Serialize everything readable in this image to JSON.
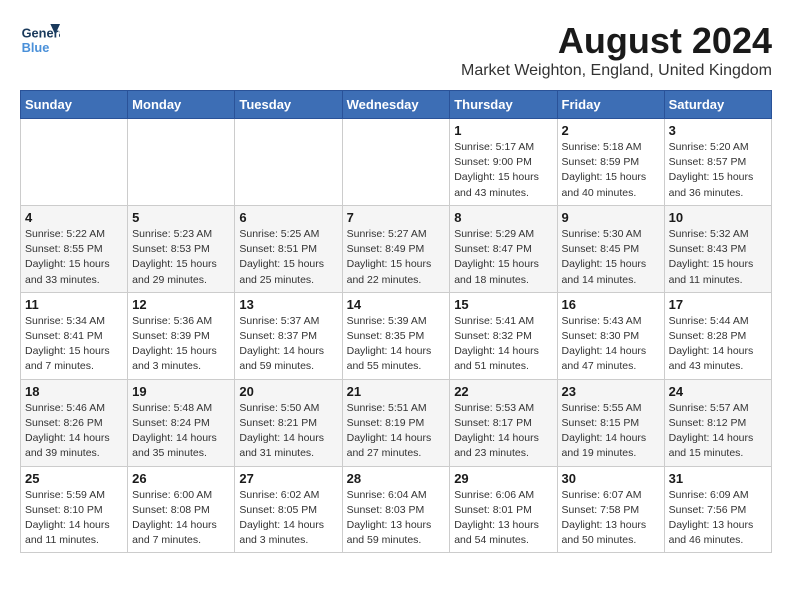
{
  "header": {
    "logo_general": "General",
    "logo_blue": "Blue",
    "month_year": "August 2024",
    "location": "Market Weighton, England, United Kingdom"
  },
  "weekdays": [
    "Sunday",
    "Monday",
    "Tuesday",
    "Wednesday",
    "Thursday",
    "Friday",
    "Saturday"
  ],
  "weeks": [
    [
      {
        "day": "",
        "info": ""
      },
      {
        "day": "",
        "info": ""
      },
      {
        "day": "",
        "info": ""
      },
      {
        "day": "",
        "info": ""
      },
      {
        "day": "1",
        "info": "Sunrise: 5:17 AM\nSunset: 9:00 PM\nDaylight: 15 hours\nand 43 minutes."
      },
      {
        "day": "2",
        "info": "Sunrise: 5:18 AM\nSunset: 8:59 PM\nDaylight: 15 hours\nand 40 minutes."
      },
      {
        "day": "3",
        "info": "Sunrise: 5:20 AM\nSunset: 8:57 PM\nDaylight: 15 hours\nand 36 minutes."
      }
    ],
    [
      {
        "day": "4",
        "info": "Sunrise: 5:22 AM\nSunset: 8:55 PM\nDaylight: 15 hours\nand 33 minutes."
      },
      {
        "day": "5",
        "info": "Sunrise: 5:23 AM\nSunset: 8:53 PM\nDaylight: 15 hours\nand 29 minutes."
      },
      {
        "day": "6",
        "info": "Sunrise: 5:25 AM\nSunset: 8:51 PM\nDaylight: 15 hours\nand 25 minutes."
      },
      {
        "day": "7",
        "info": "Sunrise: 5:27 AM\nSunset: 8:49 PM\nDaylight: 15 hours\nand 22 minutes."
      },
      {
        "day": "8",
        "info": "Sunrise: 5:29 AM\nSunset: 8:47 PM\nDaylight: 15 hours\nand 18 minutes."
      },
      {
        "day": "9",
        "info": "Sunrise: 5:30 AM\nSunset: 8:45 PM\nDaylight: 15 hours\nand 14 minutes."
      },
      {
        "day": "10",
        "info": "Sunrise: 5:32 AM\nSunset: 8:43 PM\nDaylight: 15 hours\nand 11 minutes."
      }
    ],
    [
      {
        "day": "11",
        "info": "Sunrise: 5:34 AM\nSunset: 8:41 PM\nDaylight: 15 hours\nand 7 minutes."
      },
      {
        "day": "12",
        "info": "Sunrise: 5:36 AM\nSunset: 8:39 PM\nDaylight: 15 hours\nand 3 minutes."
      },
      {
        "day": "13",
        "info": "Sunrise: 5:37 AM\nSunset: 8:37 PM\nDaylight: 14 hours\nand 59 minutes."
      },
      {
        "day": "14",
        "info": "Sunrise: 5:39 AM\nSunset: 8:35 PM\nDaylight: 14 hours\nand 55 minutes."
      },
      {
        "day": "15",
        "info": "Sunrise: 5:41 AM\nSunset: 8:32 PM\nDaylight: 14 hours\nand 51 minutes."
      },
      {
        "day": "16",
        "info": "Sunrise: 5:43 AM\nSunset: 8:30 PM\nDaylight: 14 hours\nand 47 minutes."
      },
      {
        "day": "17",
        "info": "Sunrise: 5:44 AM\nSunset: 8:28 PM\nDaylight: 14 hours\nand 43 minutes."
      }
    ],
    [
      {
        "day": "18",
        "info": "Sunrise: 5:46 AM\nSunset: 8:26 PM\nDaylight: 14 hours\nand 39 minutes."
      },
      {
        "day": "19",
        "info": "Sunrise: 5:48 AM\nSunset: 8:24 PM\nDaylight: 14 hours\nand 35 minutes."
      },
      {
        "day": "20",
        "info": "Sunrise: 5:50 AM\nSunset: 8:21 PM\nDaylight: 14 hours\nand 31 minutes."
      },
      {
        "day": "21",
        "info": "Sunrise: 5:51 AM\nSunset: 8:19 PM\nDaylight: 14 hours\nand 27 minutes."
      },
      {
        "day": "22",
        "info": "Sunrise: 5:53 AM\nSunset: 8:17 PM\nDaylight: 14 hours\nand 23 minutes."
      },
      {
        "day": "23",
        "info": "Sunrise: 5:55 AM\nSunset: 8:15 PM\nDaylight: 14 hours\nand 19 minutes."
      },
      {
        "day": "24",
        "info": "Sunrise: 5:57 AM\nSunset: 8:12 PM\nDaylight: 14 hours\nand 15 minutes."
      }
    ],
    [
      {
        "day": "25",
        "info": "Sunrise: 5:59 AM\nSunset: 8:10 PM\nDaylight: 14 hours\nand 11 minutes."
      },
      {
        "day": "26",
        "info": "Sunrise: 6:00 AM\nSunset: 8:08 PM\nDaylight: 14 hours\nand 7 minutes."
      },
      {
        "day": "27",
        "info": "Sunrise: 6:02 AM\nSunset: 8:05 PM\nDaylight: 14 hours\nand 3 minutes."
      },
      {
        "day": "28",
        "info": "Sunrise: 6:04 AM\nSunset: 8:03 PM\nDaylight: 13 hours\nand 59 minutes."
      },
      {
        "day": "29",
        "info": "Sunrise: 6:06 AM\nSunset: 8:01 PM\nDaylight: 13 hours\nand 54 minutes."
      },
      {
        "day": "30",
        "info": "Sunrise: 6:07 AM\nSunset: 7:58 PM\nDaylight: 13 hours\nand 50 minutes."
      },
      {
        "day": "31",
        "info": "Sunrise: 6:09 AM\nSunset: 7:56 PM\nDaylight: 13 hours\nand 46 minutes."
      }
    ]
  ]
}
